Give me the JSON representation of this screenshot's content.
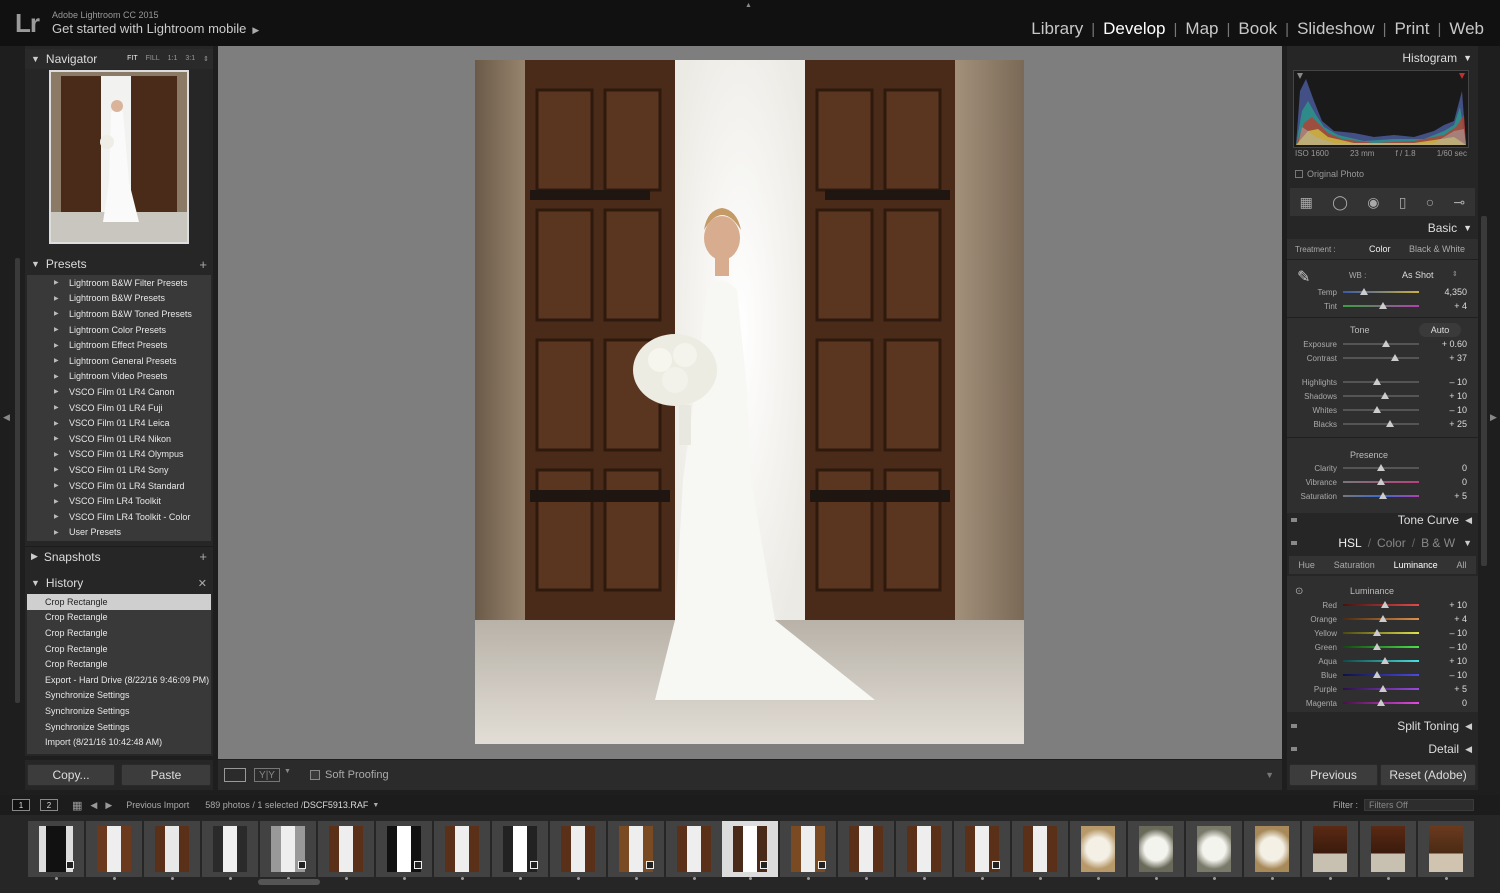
{
  "top": {
    "logo": "Lr",
    "app_name": "Adobe Lightroom CC 2015",
    "mobile_prompt": "Get started with Lightroom mobile",
    "modules": [
      "Library",
      "Develop",
      "Map",
      "Book",
      "Slideshow",
      "Print",
      "Web"
    ],
    "active_module": "Develop"
  },
  "navigator": {
    "title": "Navigator",
    "zoom_options": [
      "FIT",
      "FILL",
      "1:1",
      "3:1"
    ],
    "active_zoom": "FIT"
  },
  "presets": {
    "title": "Presets",
    "items": [
      "Lightroom B&W Filter Presets",
      "Lightroom B&W Presets",
      "Lightroom B&W Toned Presets",
      "Lightroom Color Presets",
      "Lightroom Effect Presets",
      "Lightroom General Presets",
      "Lightroom Video Presets",
      "VSCO Film 01 LR4 Canon",
      "VSCO Film 01 LR4 Fuji",
      "VSCO Film 01 LR4 Leica",
      "VSCO Film 01 LR4 Nikon",
      "VSCO Film 01 LR4 Olympus",
      "VSCO Film 01 LR4 Sony",
      "VSCO Film 01 LR4 Standard",
      "VSCO Film LR4 Toolkit",
      "VSCO Film LR4 Toolkit - Color",
      "User Presets"
    ]
  },
  "snapshots": {
    "title": "Snapshots"
  },
  "history": {
    "title": "History",
    "items": [
      "Crop Rectangle",
      "Crop Rectangle",
      "Crop Rectangle",
      "Crop Rectangle",
      "Crop Rectangle",
      "Export - Hard Drive (8/22/16 9:46:09 PM)",
      "Synchronize Settings",
      "Synchronize Settings",
      "Synchronize Settings",
      "Import (8/21/16 10:42:48 AM)"
    ]
  },
  "left_buttons": {
    "copy": "Copy...",
    "paste": "Paste"
  },
  "toolbar": {
    "soft_proofing": "Soft Proofing"
  },
  "histogram": {
    "title": "Histogram",
    "iso": "ISO 1600",
    "focal": "23 mm",
    "aperture": "f / 1.8",
    "shutter": "1/60 sec",
    "original_photo": "Original Photo"
  },
  "basic": {
    "title": "Basic",
    "treatment_label": "Treatment :",
    "treatment_color": "Color",
    "treatment_bw": "Black & White",
    "wb_label": "WB :",
    "wb_value": "As Shot",
    "temp": {
      "label": "Temp",
      "value": "4,350",
      "level": 0.28
    },
    "tint": {
      "label": "Tint",
      "value": "+ 4",
      "level": 0.52
    },
    "tone_label": "Tone",
    "auto_label": "Auto",
    "exposure": {
      "label": "Exposure",
      "value": "+ 0.60",
      "level": 0.56
    },
    "contrast": {
      "label": "Contrast",
      "value": "+ 37",
      "level": 0.68
    },
    "highlights": {
      "label": "Highlights",
      "value": "– 10",
      "level": 0.45
    },
    "shadows": {
      "label": "Shadows",
      "value": "+ 10",
      "level": 0.55
    },
    "whites": {
      "label": "Whites",
      "value": "– 10",
      "level": 0.45
    },
    "blacks": {
      "label": "Blacks",
      "value": "+ 25",
      "level": 0.62
    },
    "presence_label": "Presence",
    "clarity": {
      "label": "Clarity",
      "value": "0",
      "level": 0.5
    },
    "vibrance": {
      "label": "Vibrance",
      "value": "0",
      "level": 0.5
    },
    "saturation": {
      "label": "Saturation",
      "value": "+ 5",
      "level": 0.52
    }
  },
  "tone_curve": {
    "title": "Tone Curve"
  },
  "hsl": {
    "tabs_header": [
      "HSL",
      "Color",
      "B & W"
    ],
    "subtabs": [
      "Hue",
      "Saturation",
      "Luminance",
      "All"
    ],
    "active_subtab": "Luminance",
    "section_label": "Luminance",
    "rows": [
      {
        "label": "Red",
        "value": "+ 10",
        "level": 0.55
      },
      {
        "label": "Orange",
        "value": "+ 4",
        "level": 0.52
      },
      {
        "label": "Yellow",
        "value": "– 10",
        "level": 0.45
      },
      {
        "label": "Green",
        "value": "– 10",
        "level": 0.45
      },
      {
        "label": "Aqua",
        "value": "+ 10",
        "level": 0.55
      },
      {
        "label": "Blue",
        "value": "– 10",
        "level": 0.45
      },
      {
        "label": "Purple",
        "value": "+ 5",
        "level": 0.52
      },
      {
        "label": "Magenta",
        "value": "0",
        "level": 0.5
      }
    ]
  },
  "split_toning": {
    "title": "Split Toning"
  },
  "detail": {
    "title": "Detail"
  },
  "right_buttons": {
    "previous": "Previous",
    "reset": "Reset (Adobe)"
  },
  "filmbar": {
    "page1": "1",
    "page2": "2",
    "source": "Previous Import",
    "count": "589 photos / 1 selected /",
    "filename": "DSCF5913.RAF",
    "filter_label": "Filter :",
    "filter_value": "Filters Off"
  },
  "colors": {
    "panel": "#262626",
    "panel_list": "#393939",
    "center_bg": "#7e7e7e",
    "topbar": "#111111",
    "door": "#4a2a18"
  }
}
